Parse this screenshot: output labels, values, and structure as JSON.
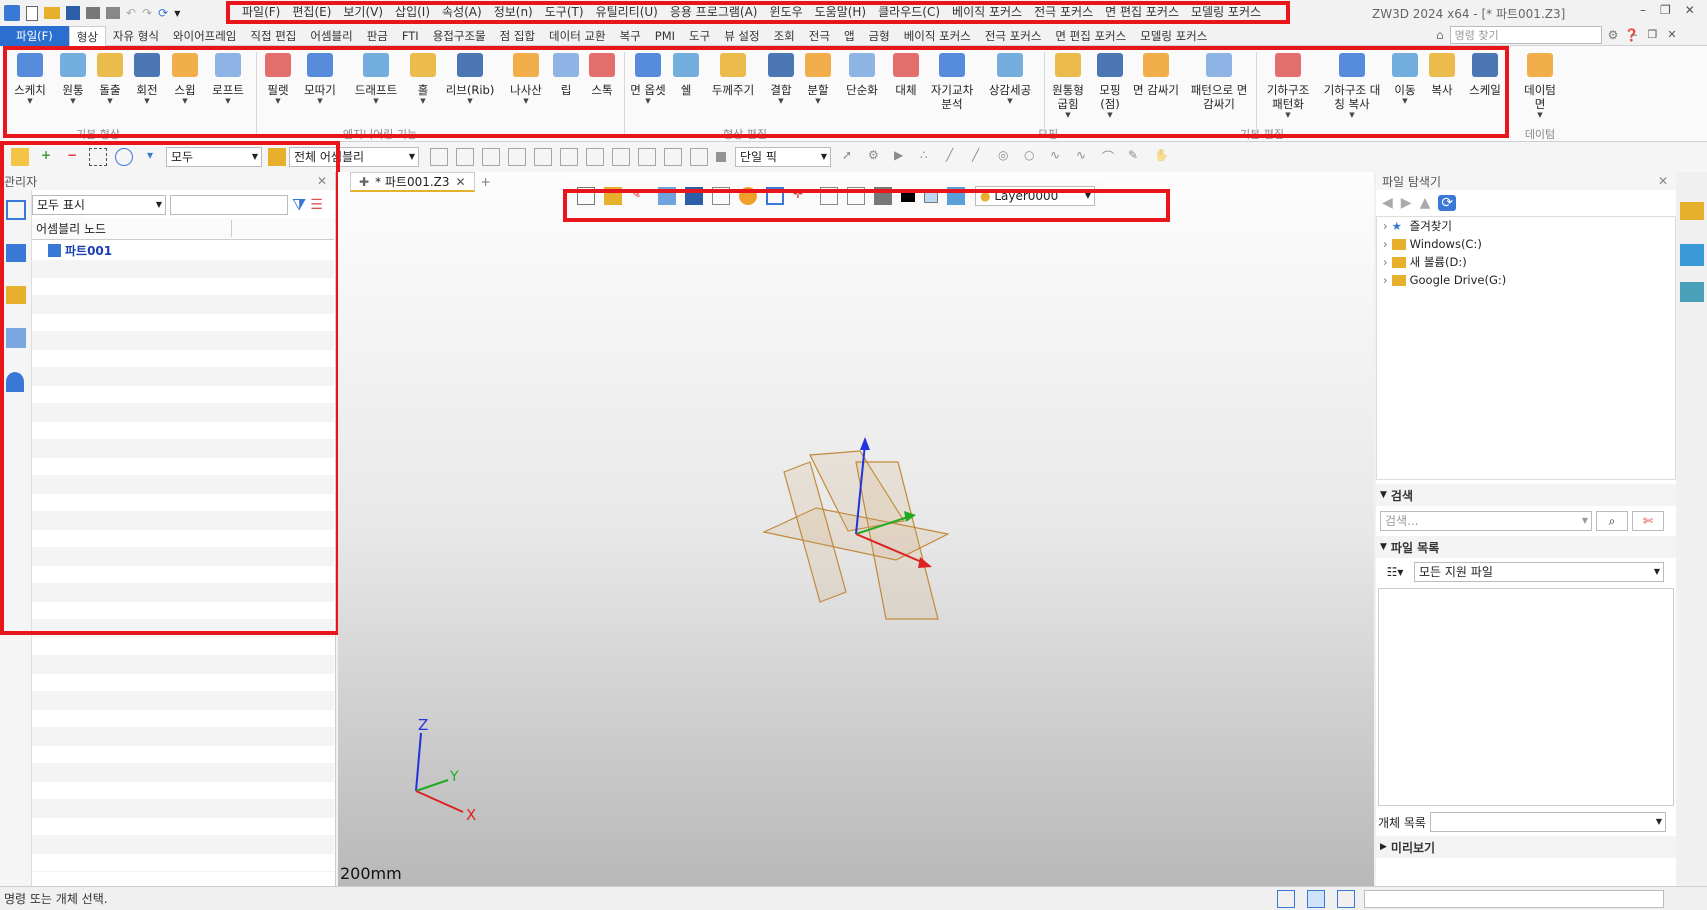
{
  "app_title": "ZW3D 2024 x64 - [* 파트001.Z3]",
  "menu": [
    "파일(F)",
    "편집(E)",
    "보기(V)",
    "삽입(I)",
    "속성(A)",
    "정보(n)",
    "도구(T)",
    "유틸리티(U)",
    "응용 프로그램(A)",
    "윈도우",
    "도움말(H)",
    "클라우드(C)",
    "베이직 포커스",
    "전극 포커스",
    "면 편집 포커스",
    "모델링 포커스"
  ],
  "ribbon_tabs": [
    "파일(F)",
    "형상",
    "자유 형식",
    "와이어프레임",
    "직접 편집",
    "어셈블리",
    "판금",
    "FTI",
    "용접구조물",
    "점 집합",
    "데이터 교환",
    "복구",
    "PMI",
    "도구",
    "뷰 설정",
    "조회",
    "전극",
    "앱",
    "금형",
    "베이직 포커스",
    "전극 포커스",
    "면 편집 포커스",
    "모델링 포커스"
  ],
  "command_search_placeholder": "명령 찾기",
  "ribbon": {
    "buttons": [
      {
        "label": "스케치",
        "icon": "sketch-icon"
      },
      {
        "label": "원통",
        "icon": "cylinder-icon"
      },
      {
        "label": "돌출",
        "icon": "extrude-icon"
      },
      {
        "label": "회전",
        "icon": "revolve-icon"
      },
      {
        "label": "스윕",
        "icon": "sweep-icon"
      },
      {
        "label": "로프트",
        "icon": "loft-icon"
      },
      {
        "label": "필렛",
        "icon": "fillet-icon"
      },
      {
        "label": "모따기",
        "icon": "chamfer-icon"
      },
      {
        "label": "드래프트",
        "icon": "draft-icon"
      },
      {
        "label": "홀",
        "icon": "hole-icon"
      },
      {
        "label": "리브(Rib)",
        "icon": "rib-icon"
      },
      {
        "label": "나사산",
        "icon": "thread-icon"
      },
      {
        "label": "립",
        "icon": "lip-icon"
      },
      {
        "label": "스톡",
        "icon": "stock-icon"
      },
      {
        "label": "면 옵셋",
        "icon": "face-offset-icon"
      },
      {
        "label": "쉘",
        "icon": "shell-icon"
      },
      {
        "label": "두께주기",
        "icon": "thicken-icon"
      },
      {
        "label": "결합",
        "icon": "combine-icon"
      },
      {
        "label": "분할",
        "icon": "divide-icon"
      },
      {
        "label": "단순화",
        "icon": "simplify-icon"
      },
      {
        "label": "대체",
        "icon": "replace-icon"
      },
      {
        "label": "자기교차\n분석",
        "icon": "self-intersect-icon"
      },
      {
        "label": "상감세공",
        "icon": "emboss-icon"
      },
      {
        "label": "원통형\n굽힘",
        "icon": "cylindrical-bend-icon"
      },
      {
        "label": "모핑\n(점)",
        "icon": "morph-icon"
      },
      {
        "label": "면 감싸기",
        "icon": "wrap-face-icon"
      },
      {
        "label": "패턴으로 면\n감싸기",
        "icon": "wrap-pattern-icon"
      },
      {
        "label": "기하구조\n패턴화",
        "icon": "pattern-icon"
      },
      {
        "label": "기하구조 대\n칭 복사",
        "icon": "mirror-icon"
      },
      {
        "label": "이동",
        "icon": "move-icon"
      },
      {
        "label": "복사",
        "icon": "copy-icon"
      },
      {
        "label": "스케일",
        "icon": "scale-icon"
      },
      {
        "label": "데이텀\n면",
        "icon": "datum-plane-icon"
      }
    ],
    "groups": [
      "기본 형상",
      "엔지니어링 기능",
      "형상 편집",
      "모핑",
      "기본 편집",
      "데이텀"
    ]
  },
  "cmdbar": {
    "filter": "모두",
    "assembly": "전체 어셈블리",
    "pick": "단일 픽"
  },
  "manager": {
    "title": "관리자",
    "show": "모두 표시",
    "col_header": "어셈블리 노드",
    "node": "파트001"
  },
  "doc_tab": "* 파트001.Z3",
  "viewport": {
    "layer": "Layer0000",
    "scale": "200mm",
    "axes": {
      "z": "Z",
      "y": "Y",
      "x": "X"
    }
  },
  "explorer": {
    "title": "파일 탐색기",
    "tree": [
      "즐겨찾기",
      "Windows(C:)",
      "새 볼륨(D:)",
      "Google Drive(G:)"
    ],
    "search_section": "검색",
    "search_placeholder": "검색...",
    "files_section": "파일 목록",
    "file_filter": "모든 지원 파일",
    "object_list": "개체 목록",
    "preview": "미리보기"
  },
  "status": "명령 또는 개체 선택.",
  "colors": {
    "red_box": "#e8151b",
    "file_tab": "#2a6fd0"
  }
}
